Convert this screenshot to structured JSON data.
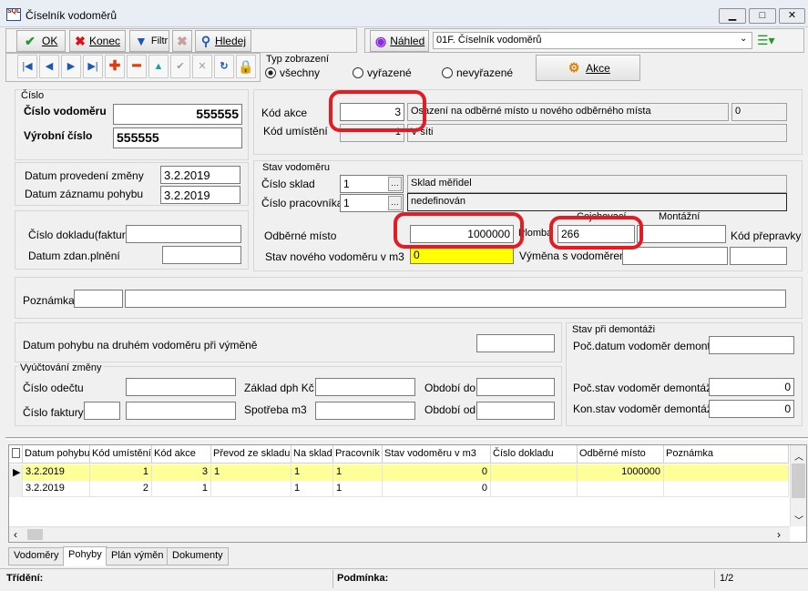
{
  "window": {
    "title": "Číselník vodoměrů",
    "logo": "SQL"
  },
  "toolbar": {
    "ok": "OK",
    "konec": "Konec",
    "filtr": "Filtr",
    "hledej": "Hledej",
    "nahled": "Náhled",
    "report": "01F. Číselník vodoměrů",
    "akce": "Akce",
    "typ_title": "Typ zobrazení",
    "typ_options": [
      "všechny",
      "vyřazené",
      "nevyřazené"
    ],
    "typ_selected": "všechny"
  },
  "cislo": {
    "group": "Číslo",
    "vodomer_label": "Číslo vodoměru",
    "vodomer_value": "555555",
    "vyrobni_label": "Výrobní číslo",
    "vyrobni_value": "555555"
  },
  "akce": {
    "kod_label": "Kód akce",
    "kod_value": "3",
    "kod_desc": "Osazení na odběrné místo u nového odběrného místa",
    "kod_extra": "0",
    "umisteni_label": "Kód umístění",
    "umisteni_value": "1",
    "umisteni_desc": "V síti"
  },
  "datum": {
    "zmena_label": "Datum provedení změny",
    "zmena_value": "3.2.2019",
    "zaznam_label": "Datum záznamu pohybu",
    "zaznam_value": "3.2.2019"
  },
  "doklad": {
    "cislo_label": "Číslo dokladu(faktury)",
    "zdan_label": "Datum zdan.plnění"
  },
  "stav": {
    "group": "Stav vodoměru",
    "sklad_label": "Číslo sklad",
    "sklad_value": "1",
    "sklad_desc": "Sklad měřidel",
    "prac_label": "Číslo pracovníka",
    "prac_value": "1",
    "prac_desc": "nedefinován",
    "odber_label": "Odběrné místo",
    "odber_value": "1000000",
    "plomba_label": "Plomba",
    "cejch_label": "Cejchovací",
    "mont_label": "Montážní",
    "plomba_value": "266",
    "prepravky_label": "Kód přepravky",
    "novy_label": "Stav nového vodoměru v m3",
    "novy_value": "0",
    "vymena_label": "Výměna s vodoměrem"
  },
  "poznamka": {
    "label": "Poznámka"
  },
  "druhy": {
    "label": "Datum pohybu na druhém vodoměru při výměně"
  },
  "vyuct": {
    "group": "Vyúčtování změny",
    "odectu": "Číslo odečtu",
    "faktury": "Číslo faktury",
    "zaklad": "Základ dph Kč",
    "spotreba": "Spotřeba m3",
    "obdobi_do": "Období do",
    "obdobi_od": "Období od"
  },
  "demontaz": {
    "group": "Stav při demontáži",
    "datum": "Poč.datum vodoměr demontáž",
    "poc": "Poč.stav vodoměr demontáž",
    "poc_value": "0",
    "kon": "Kon.stav vodoměr demontáž",
    "kon_value": "0"
  },
  "grid": {
    "columns": [
      "Datum pohybu",
      "Kód umístění",
      "Kód akce",
      "Převod ze skladu",
      "Na sklad",
      "Pracovník",
      "Stav vodoměru v m3",
      "Číslo dokladu",
      "Odběrné místo",
      "Poznámka"
    ],
    "rows": [
      [
        "3.2.2019",
        "1",
        "3",
        "1",
        "1",
        "1",
        "0",
        "",
        "1000000",
        ""
      ],
      [
        "3.2.2019",
        "2",
        "1",
        "",
        "1",
        "1",
        "0",
        "",
        "",
        ""
      ]
    ]
  },
  "tabs": [
    "Vodoměry",
    "Pohyby",
    "Plán výměn",
    "Dokumenty"
  ],
  "tab_active": "Pohyby",
  "status": {
    "trideni": "Třídění:",
    "podminka": "Podmínka:",
    "page": "1/2"
  },
  "colors": {
    "accent_red": "#e31c23",
    "selected_row": "#ffff99",
    "highlight_input": "#ffff00"
  }
}
